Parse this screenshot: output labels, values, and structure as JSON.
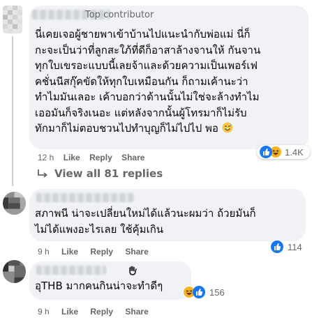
{
  "comments": [
    {
      "badge": "Top contributor",
      "lines": [
        "นี่เคยเจอผู้ชายพาเข้าบ้านไปแนะนำกับพ่อแม่ นี่ก็",
        "กะจะเป็นว่าที่ลูกสะใภ้ที่ดีก็อาสาล้างจานให้ กันจาน",
        "ทุกใบเขรอะแบบนี้เลยจ้าและด้วยความเป็นเพอร์เฟ",
        "คชั่นนีสกุ๊คขัดให้ทุกใบเหมือนกัน ก็ถามเค้านะว่า",
        "ทำไมมันเลอะ เค้าบอกว่าด้านนั้นไม่ใช่จะล้างทำไม",
        "เออมันก็จริงเนอะ แต่หลังจากนั้นผู้โทรมาก็ไม่รับ",
        "ทักมาก็ไม่ตอบชวนไปทำบุญก็ไม่ไปไป พอ"
      ],
      "emoji": "smiling-face-sweat",
      "time": "12 h",
      "like": "Like",
      "reply": "Reply",
      "share": "Share",
      "reaction_count": "1.4K",
      "reactions": [
        "like",
        "haha"
      ]
    },
    {
      "badge": "",
      "lines": [
        "สภาพนี น่าจะเปลี่ยนใหม่ได้แล้วนะผมว่า ถ้วยมันก็",
        "ไม่ได้แพงอะไรเลย ใช้คุ้มเกิน"
      ],
      "time": "9 h",
      "like": "Like",
      "reply": "Reply",
      "share": "Share",
      "reaction_count": "114",
      "reactions": [
        "like"
      ]
    },
    {
      "badge": "",
      "lines": [
        "อุTHB มากคนกินน่าจะทำดีๆ"
      ],
      "time": "9 h",
      "like": "Like",
      "reply": "Reply",
      "share": "Share",
      "reaction_count": "156",
      "reactions": [
        "haha",
        "like"
      ]
    }
  ],
  "view_all": "View all 81 replies",
  "colors": {
    "like_blue": "#1877f2",
    "haha_yellow": "#f7b125",
    "meta_gray": "#65676b",
    "bubble": "#f0f2f5"
  }
}
